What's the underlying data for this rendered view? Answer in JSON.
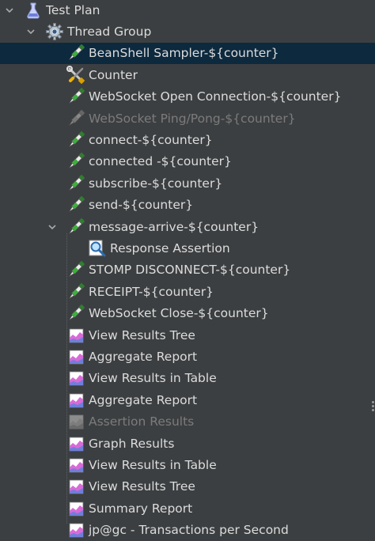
{
  "tree": {
    "nodes": [
      {
        "label": "Test Plan",
        "icon": "test-plan-flask-icon",
        "level": 0,
        "expanded": true
      },
      {
        "label": "Thread Group",
        "icon": "thread-group-gear-icon",
        "level": 1,
        "expanded": true
      },
      {
        "label": "BeanShell Sampler-${counter}",
        "icon": "sampler-pipette-icon",
        "level": 2,
        "selected": true
      },
      {
        "label": "Counter",
        "icon": "config-tools-icon",
        "level": 2
      },
      {
        "label": "WebSocket Open Connection-${counter}",
        "icon": "sampler-pipette-icon",
        "level": 2
      },
      {
        "label": "WebSocket Ping/Pong-${counter}",
        "icon": "sampler-pipette-icon",
        "level": 2,
        "disabled": true
      },
      {
        "label": "connect-${counter}",
        "icon": "sampler-pipette-icon",
        "level": 2
      },
      {
        "label": "connected -${counter}",
        "icon": "sampler-pipette-icon",
        "level": 2
      },
      {
        "label": "subscribe-${counter}",
        "icon": "sampler-pipette-icon",
        "level": 2
      },
      {
        "label": "send-${counter}",
        "icon": "sampler-pipette-icon",
        "level": 2
      },
      {
        "label": "message-arrive-${counter}",
        "icon": "sampler-pipette-icon",
        "level": 2,
        "expanded": true
      },
      {
        "label": "Response Assertion",
        "icon": "assertion-magnifier-icon",
        "level": 3
      },
      {
        "label": "STOMP DISCONNECT-${counter}",
        "icon": "sampler-pipette-icon",
        "level": 2
      },
      {
        "label": "RECEIPT-${counter}",
        "icon": "sampler-pipette-icon",
        "level": 2
      },
      {
        "label": "WebSocket Close-${counter}",
        "icon": "sampler-pipette-icon",
        "level": 2
      },
      {
        "label": "View Results Tree",
        "icon": "listener-graph-icon",
        "level": 2
      },
      {
        "label": "Aggregate Report",
        "icon": "listener-graph-icon",
        "level": 2
      },
      {
        "label": "View Results in Table",
        "icon": "listener-graph-icon",
        "level": 2
      },
      {
        "label": "Aggregate Report",
        "icon": "listener-graph-icon",
        "level": 2
      },
      {
        "label": "Assertion Results",
        "icon": "listener-graph-icon",
        "level": 2,
        "disabled": true
      },
      {
        "label": "Graph Results",
        "icon": "listener-graph-icon",
        "level": 2
      },
      {
        "label": "View Results in Table",
        "icon": "listener-graph-icon",
        "level": 2
      },
      {
        "label": "View Results Tree",
        "icon": "listener-graph-icon",
        "level": 2
      },
      {
        "label": "Summary Report",
        "icon": "listener-graph-icon",
        "level": 2
      },
      {
        "label": "jp@gc - Transactions per Second",
        "icon": "listener-graph-icon",
        "level": 2
      }
    ]
  },
  "colors": {
    "background": "#3c3f41",
    "selected_row": "#0d293e",
    "text": "#dcdcdc",
    "disabled_text": "#7b7b7b"
  }
}
